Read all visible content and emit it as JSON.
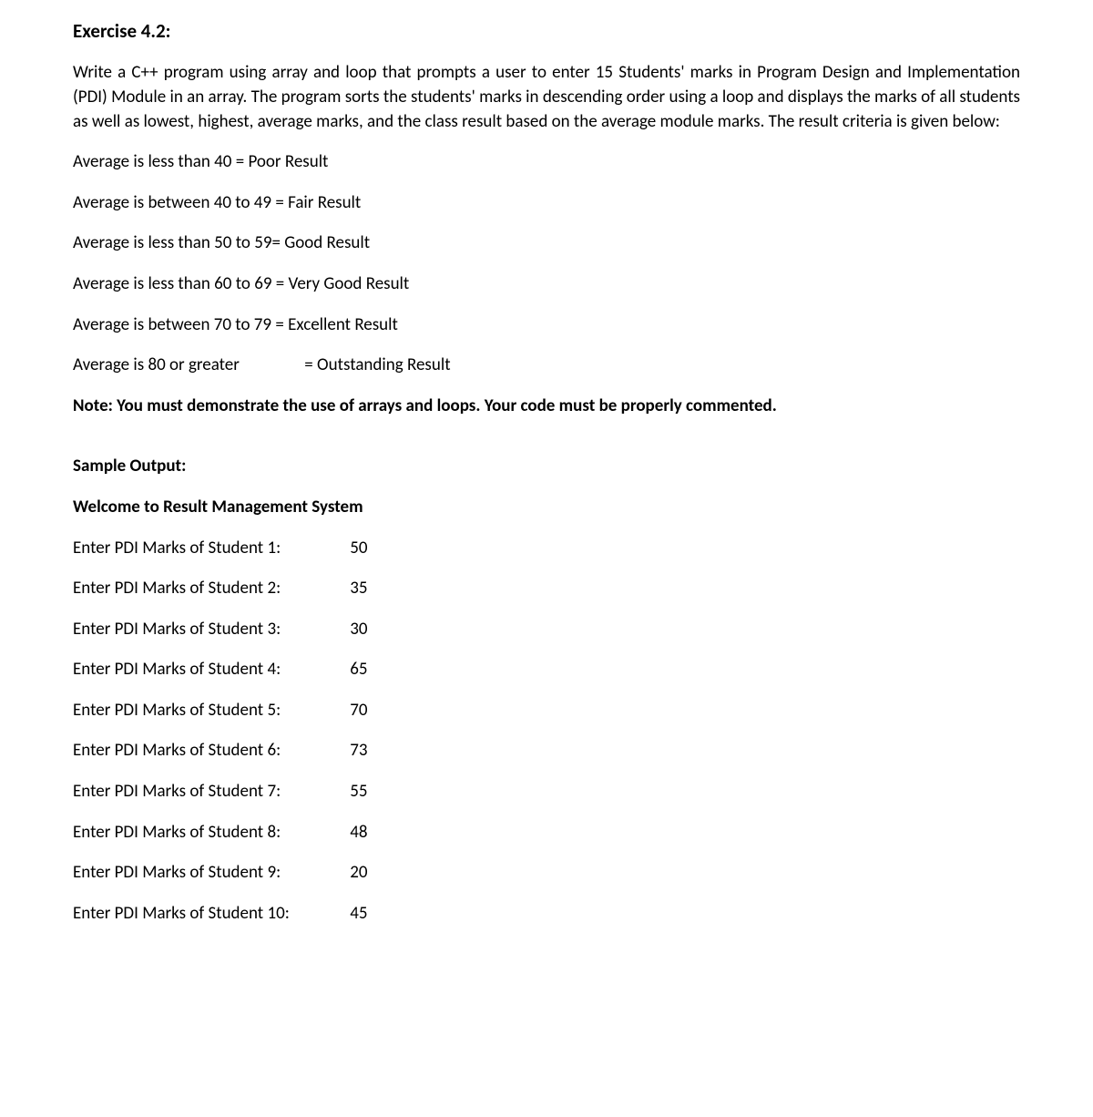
{
  "title": "Exercise 4.2:",
  "intro": "Write a C++ program using array and loop that prompts a user to enter 15 Students' marks in Program Design and Implementation (PDI) Module in an array. The program sorts the students' marks in descending order using a loop and displays the marks of all students as well as lowest, highest, average marks, and the class result based on the average module marks. The result criteria is given below:",
  "criteria": [
    "Average is less than 40 = Poor Result",
    "Average is between 40 to 49 = Fair Result",
    "Average is less than 50 to 59= Good Result",
    "Average is less than 60 to 69 = Very Good Result",
    "Average is between 70 to 79 = Excellent Result"
  ],
  "criteria_last": {
    "label": "Average is 80 or greater",
    "result": "= Outstanding Result"
  },
  "note": "Note: You must demonstrate the use of arrays and loops. Your code must be properly commented.",
  "sample_output_heading": "Sample Output:",
  "welcome": "Welcome to Result Management System",
  "entries": [
    {
      "label": "Enter PDI Marks of Student 1:",
      "value": "50"
    },
    {
      "label": "Enter PDI Marks of Student 2:",
      "value": "35"
    },
    {
      "label": "Enter PDI Marks of Student 3:",
      "value": "30"
    },
    {
      "label": "Enter PDI Marks of Student 4:",
      "value": "65"
    },
    {
      "label": "Enter PDI Marks of Student 5:",
      "value": "70"
    },
    {
      "label": "Enter PDI Marks of Student 6:",
      "value": "73"
    },
    {
      "label": "Enter PDI Marks of Student 7:",
      "value": "55"
    },
    {
      "label": "Enter PDI Marks of Student 8:",
      "value": "48"
    },
    {
      "label": "Enter PDI Marks of Student 9:",
      "value": "20"
    },
    {
      "label": "Enter PDI Marks of Student 10:",
      "value": "45"
    }
  ]
}
